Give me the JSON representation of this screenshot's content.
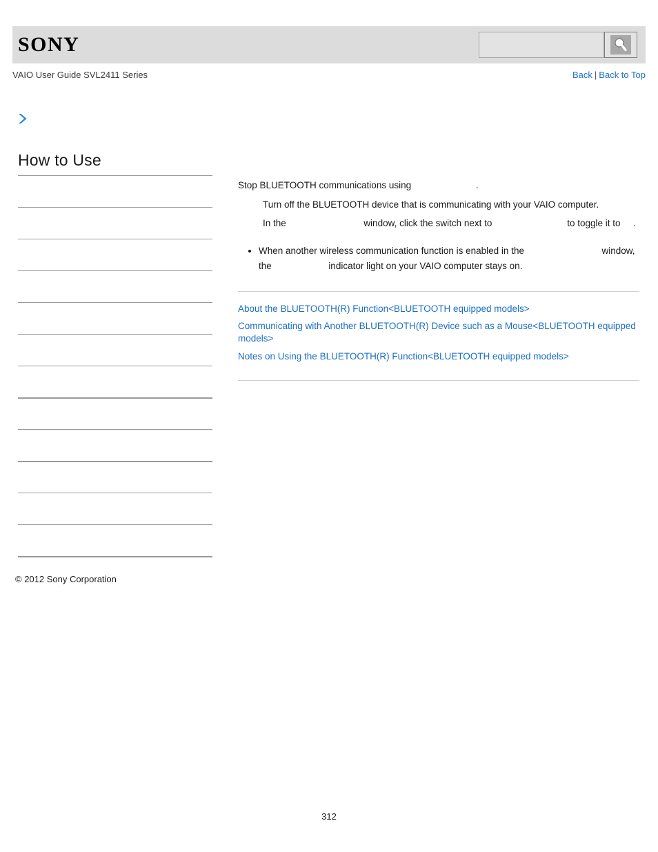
{
  "header": {
    "brand": "SONY",
    "search": {
      "value": "",
      "placeholder": "",
      "button_icon": "search-icon"
    }
  },
  "title_row": {
    "guide_title": "VAIO User Guide SVL2411 Series",
    "back_label": "Back",
    "separator": "|",
    "back_to_top_label": "Back to Top"
  },
  "breadcrumb_icon": "chevron-right-icon",
  "sidebar": {
    "heading": "How to Use",
    "items": [
      {
        "label": ""
      },
      {
        "label": ""
      },
      {
        "label": ""
      },
      {
        "label": ""
      },
      {
        "label": ""
      },
      {
        "label": ""
      },
      {
        "label": ""
      },
      {
        "label": ""
      },
      {
        "label": ""
      },
      {
        "label": ""
      },
      {
        "label": ""
      },
      {
        "label": ""
      }
    ]
  },
  "content": {
    "lead_prefix": "Stop BLUETOOTH communications using",
    "lead_term": "                         ",
    "lead_suffix": ".",
    "steps": [
      {
        "text_1": "Turn off the BLUETOOTH device that is communicating with your VAIO computer.",
        "term_1": "",
        "text_2": "",
        "term_2": "",
        "text_3": ""
      },
      {
        "text_1": "In the",
        "term_1": "                              ",
        "text_2": "window, click the switch next to",
        "term_2": "                             ",
        "text_3": "to toggle it to",
        "term_3": "     ",
        "text_4": "."
      }
    ],
    "notes": [
      {
        "text_1": "When another wireless communication function is enabled in the",
        "term_1": "                              ",
        "text_2": "window, the",
        "term_2": "                      ",
        "text_3": "indicator light on your VAIO computer stays on."
      }
    ],
    "related_links": [
      "About the BLUETOOTH(R) Function<BLUETOOTH equipped models>",
      "Communicating with Another BLUETOOTH(R) Device such as a Mouse<BLUETOOTH equipped models>",
      "Notes on Using the BLUETOOTH(R) Function<BLUETOOTH equipped models>"
    ]
  },
  "footer": {
    "copyright": "© 2012 Sony Corporation",
    "page_number": "312"
  },
  "colors": {
    "link": "#1a6fc4",
    "header_bg": "#dcdcdc",
    "rule": "#cfcfcf",
    "sidebar_rule": "#9a9a9a",
    "chevron": "#2b8cd4"
  }
}
